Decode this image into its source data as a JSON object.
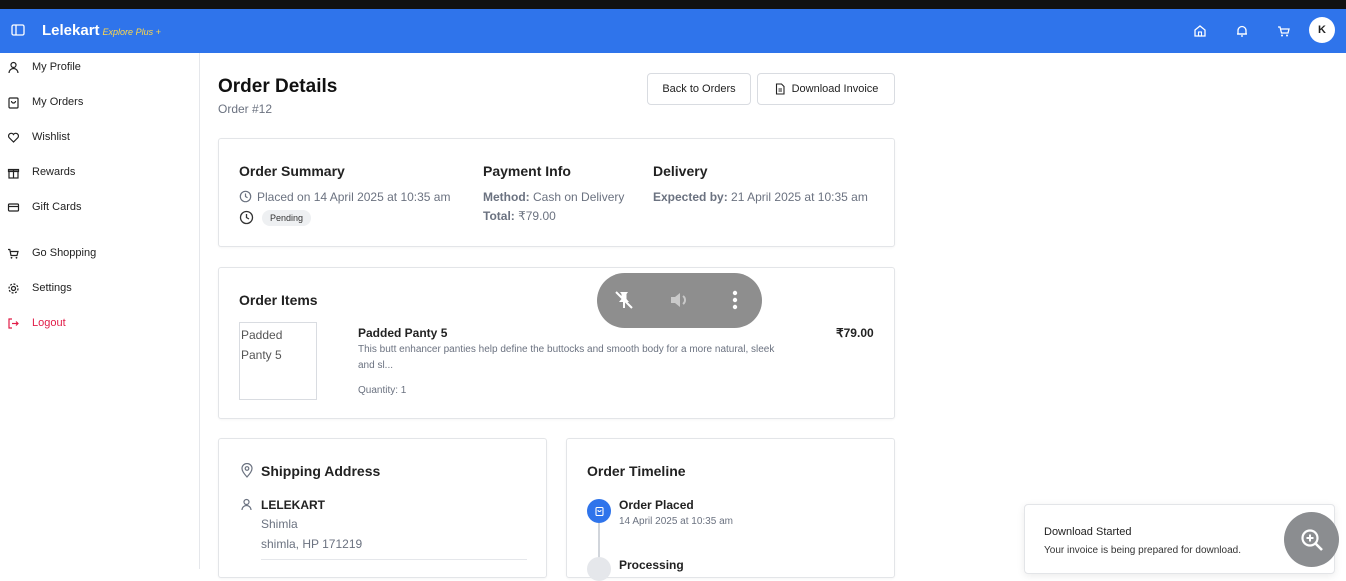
{
  "header": {
    "brand": "Lelekart",
    "brand_sub": "Explore Plus +",
    "avatar_initial": "K",
    "icons": [
      "sidebar-toggle-icon",
      "home-icon",
      "bell-icon",
      "cart-icon"
    ]
  },
  "sidebar": {
    "items": [
      {
        "label": "My Profile",
        "icon": "user-icon"
      },
      {
        "label": "My Orders",
        "icon": "bag-icon"
      },
      {
        "label": "Wishlist",
        "icon": "heart-icon"
      },
      {
        "label": "Rewards",
        "icon": "gift-icon"
      },
      {
        "label": "Gift Cards",
        "icon": "card-icon"
      },
      {
        "label": "Go Shopping",
        "icon": "cart-icon"
      },
      {
        "label": "Settings",
        "icon": "gear-icon"
      },
      {
        "label": "Logout",
        "icon": "logout-icon"
      }
    ],
    "logout_color": "#e11d48"
  },
  "page": {
    "title": "Order Details",
    "order_no": "Order #12",
    "back_label": "Back to Orders",
    "download_label": "Download Invoice"
  },
  "summary": {
    "title": "Order Summary",
    "placed": "Placed on 14 April 2025 at 10:35 am",
    "status": "Pending",
    "payment_title": "Payment Info",
    "method_label": "Method:",
    "method_value": "Cash on Delivery",
    "total_label": "Total:",
    "total_value": "₹79.00",
    "delivery_title": "Delivery",
    "expected_label": "Expected by:",
    "expected_value": "21 April 2025 at 10:35 am"
  },
  "items": {
    "title": "Order Items",
    "list": [
      {
        "image_alt": "Padded Panty 5",
        "name": "Padded Panty 5",
        "description_line1": "This butt enhancer panties help define the buttocks and smooth body for a more natural, sleek",
        "description_line2": "and sl...",
        "quantity": "Quantity: 1",
        "price": "₹79.00"
      }
    ]
  },
  "shipping": {
    "title": "Shipping Address",
    "name": "LELEKART",
    "line1": "Shimla",
    "line2": "shimla, HP 171219"
  },
  "timeline": {
    "title": "Order Timeline",
    "steps": [
      {
        "label": "Order Placed",
        "time": "14 April 2025 at 10:35 am"
      },
      {
        "label": "Processing",
        "time": ""
      }
    ],
    "active_color": "#2f74eb"
  },
  "toast": {
    "title": "Download Started",
    "message": "Your invoice is being prepared for download."
  },
  "colors": {
    "accent": "#2f74eb",
    "brand_sub": "#ffd84a"
  }
}
